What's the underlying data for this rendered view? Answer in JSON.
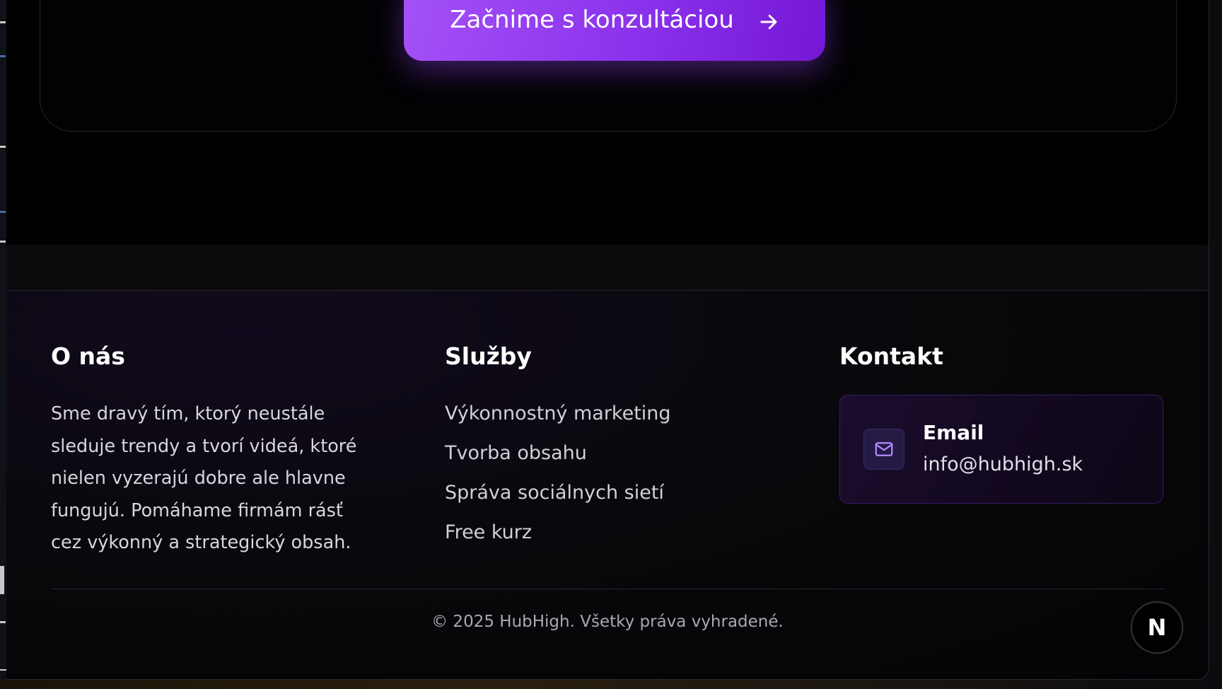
{
  "cta": {
    "button_label": "Začnime s konzultáciou",
    "icon": "arrow-right-icon"
  },
  "footer": {
    "about": {
      "heading": "O nás",
      "text": "Sme dravý tím, ktorý neustále sleduje trendy a tvorí videá, ktoré nielen vyzerajú dobre ale hlavne fungujú. Pomáhame firmám rásť cez výkonný a strategický obsah."
    },
    "services": {
      "heading": "Služby",
      "items": [
        {
          "label": "Výkonnostný marketing"
        },
        {
          "label": "Tvorba obsahu"
        },
        {
          "label": "Správa sociálnych sietí"
        },
        {
          "label": "Free kurz"
        }
      ]
    },
    "contact": {
      "heading": "Kontakt",
      "email_label": "Email",
      "email_value": "info@hubhigh.sk",
      "icon": "mail-icon"
    },
    "copyright": "© 2025 HubHigh. Všetky práva vyhradené."
  },
  "badge": {
    "letter": "N",
    "icon": "nextjs-icon"
  },
  "colors": {
    "accent_start": "#a451f7",
    "accent_end": "#7417d6",
    "background": "#000000",
    "contact_card_border": "#3b1a66"
  }
}
